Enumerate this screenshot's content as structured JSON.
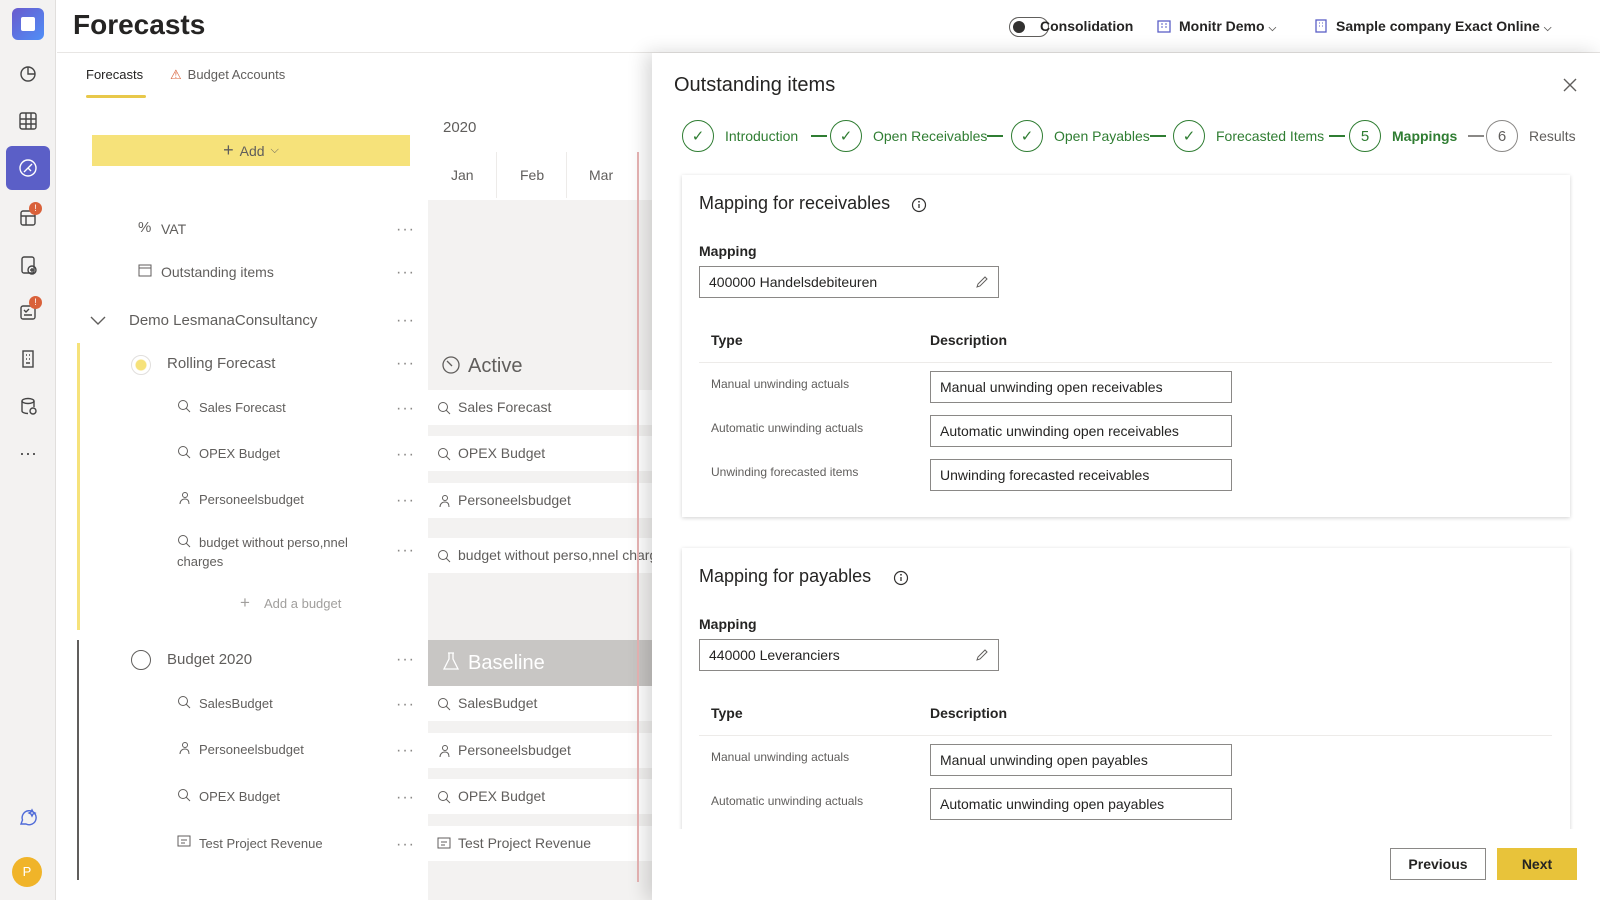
{
  "colors": {
    "accent": "#5b5fc7",
    "yellow": "#f6e27a",
    "green": "#2f7d32",
    "next": "#e8c33a"
  },
  "header": {
    "title": "Forecasts",
    "consolidation_label": "Consolidation",
    "workspace": "Monitr Demo",
    "company": "Sample company Exact Online"
  },
  "rail": {
    "avatar_initial": "P",
    "more": "···"
  },
  "tabs": [
    {
      "label": "Forecasts"
    },
    {
      "label": "Budget Accounts"
    }
  ],
  "tree": {
    "add_label": "Add",
    "items": [
      {
        "label": "VAT",
        "icon": "percent-icon"
      },
      {
        "label": "Outstanding items",
        "icon": "calendar-icon"
      },
      {
        "label": "Demo LesmanaConsultancy",
        "icon": "chevron-down-icon"
      },
      {
        "label": "Rolling Forecast",
        "icon": "radio-selected-icon"
      },
      {
        "label": "Sales Forecast",
        "icon": "budget-icon"
      },
      {
        "label": "OPEX Budget",
        "icon": "budget-icon"
      },
      {
        "label": "Personeelsbudget",
        "icon": "person-icon"
      },
      {
        "label": "budget without perso,nnel",
        "label2": "charges",
        "icon": "budget-icon"
      },
      {
        "label": "Add a budget",
        "icon": "plus-icon"
      },
      {
        "label": "Budget 2020",
        "icon": "radio-icon"
      },
      {
        "label": "SalesBudget",
        "icon": "budget-icon"
      },
      {
        "label": "Personeelsbudget",
        "icon": "person-icon"
      },
      {
        "label": "OPEX Budget",
        "icon": "budget-icon"
      },
      {
        "label": "Test Project Revenue",
        "icon": "project-icon"
      }
    ],
    "dots": "···"
  },
  "gantt": {
    "year": "2020",
    "months": [
      "Jan",
      "Feb",
      "Mar"
    ],
    "active_label": "Active",
    "baseline_label": "Baseline",
    "bars": [
      "Sales Forecast",
      "OPEX Budget",
      "Personeelsbudget",
      "budget without perso,nnel charges",
      "SalesBudget",
      "Personeelsbudget",
      "OPEX Budget",
      "Test Project Revenue"
    ]
  },
  "drawer": {
    "title": "Outstanding items",
    "steps": [
      {
        "label": "Introduction",
        "state": "done"
      },
      {
        "label": "Open Receivables",
        "state": "done"
      },
      {
        "label": "Open Payables",
        "state": "done"
      },
      {
        "label": "Forecasted Items",
        "state": "done"
      },
      {
        "number": "5",
        "label": "Mappings",
        "state": "current"
      },
      {
        "number": "6",
        "label": "Results",
        "state": "todo"
      }
    ],
    "receivables": {
      "title": "Mapping for receivables",
      "mapping_label": "Mapping",
      "mapping_value": "400000 Handelsdebiteuren",
      "col_type": "Type",
      "col_desc": "Description",
      "rows": [
        {
          "type": "Manual unwinding actuals",
          "desc": "Manual unwinding open receivables"
        },
        {
          "type": "Automatic unwinding actuals",
          "desc": "Automatic unwinding open receivables"
        },
        {
          "type": "Unwinding forecasted items",
          "desc": "Unwinding forecasted receivables"
        }
      ]
    },
    "payables": {
      "title": "Mapping for payables",
      "mapping_label": "Mapping",
      "mapping_value": "440000 Leveranciers",
      "col_type": "Type",
      "col_desc": "Description",
      "rows": [
        {
          "type": "Manual unwinding actuals",
          "desc": "Manual unwinding open payables"
        },
        {
          "type": "Automatic unwinding actuals",
          "desc": "Automatic unwinding open payables"
        }
      ]
    },
    "previous_label": "Previous",
    "next_label": "Next"
  }
}
